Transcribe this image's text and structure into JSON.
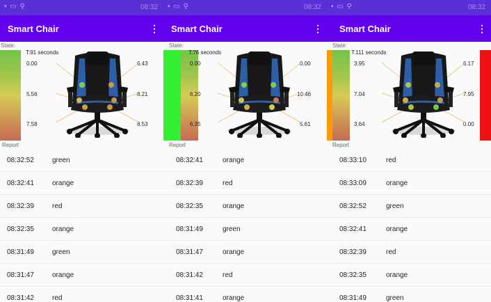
{
  "colors": {
    "statusbar": "#5b2fd6",
    "appbar": "#6200ee",
    "green": "#33ee33",
    "orange": "#ff9900",
    "red": "#ee1111"
  },
  "statusbar": {
    "icons": "▪ ▭ ⚲",
    "time": "08:32"
  },
  "panels": [
    {
      "app_title": "Smart Chair",
      "menu_icon": "⋮",
      "state_label": "State:",
      "timer": "T:91 seconds",
      "state_color": "",
      "sensors": {
        "left": [
          "0.00",
          "5.56",
          "7.58"
        ],
        "right": [
          "6.43",
          "8.21",
          "8.53"
        ]
      },
      "report_label": "Report",
      "rows": [
        {
          "time": "08:32:52",
          "color": "green"
        },
        {
          "time": "08:32:41",
          "color": "orange"
        },
        {
          "time": "08:32:39",
          "color": "red"
        },
        {
          "time": "08:32:35",
          "color": "orange"
        },
        {
          "time": "08:31:49",
          "color": "green"
        },
        {
          "time": "08:31:47",
          "color": "orange"
        },
        {
          "time": "08:31:42",
          "color": "red"
        }
      ]
    },
    {
      "app_title": "Smart Chair",
      "menu_icon": "⋮",
      "state_label": "State:",
      "timer": "T:76 seconds",
      "state_color": "green",
      "sensors": {
        "left": [
          "0.00",
          "6.20",
          "6.35"
        ],
        "right": [
          "0.00",
          "10.46",
          "5.61"
        ]
      },
      "report_label": "Report",
      "rows": [
        {
          "time": "08:32:41",
          "color": "orange"
        },
        {
          "time": "08:32:39",
          "color": "red"
        },
        {
          "time": "08:32:35",
          "color": "orange"
        },
        {
          "time": "08:31:49",
          "color": "green"
        },
        {
          "time": "08:31:47",
          "color": "orange"
        },
        {
          "time": "08:31:42",
          "color": "red"
        },
        {
          "time": "08:31:41",
          "color": "orange"
        }
      ]
    },
    {
      "app_title": "Smart Chair",
      "menu_icon": "⋮",
      "state_label": "State:",
      "timer": "T:111 seconds",
      "state_color": "orange",
      "right_state_color": "red",
      "sensors": {
        "left": [
          "3.95",
          "7.04",
          "3.64"
        ],
        "right": [
          "6.17",
          "7.95",
          "0.00"
        ]
      },
      "report_label": "Report",
      "rows": [
        {
          "time": "08:33:10",
          "color": "red"
        },
        {
          "time": "08:33:09",
          "color": "orange"
        },
        {
          "time": "08:32:52",
          "color": "green"
        },
        {
          "time": "08:32:41",
          "color": "orange"
        },
        {
          "time": "08:32:39",
          "color": "red"
        },
        {
          "time": "08:32:35",
          "color": "orange"
        },
        {
          "time": "08:31:49",
          "color": "green"
        }
      ]
    }
  ]
}
